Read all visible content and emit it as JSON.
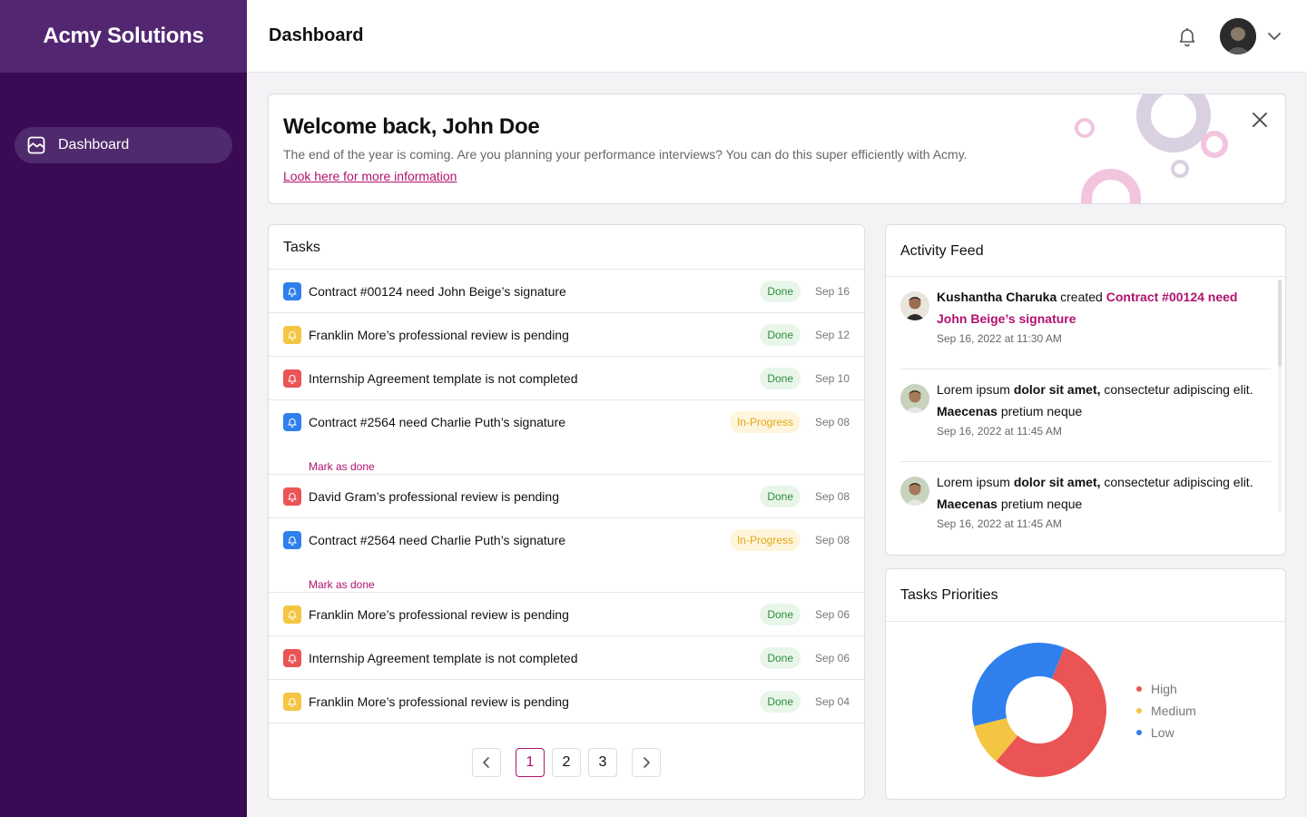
{
  "brand": {
    "name": "Acmy Solutions"
  },
  "sidebar": {
    "items": [
      {
        "label": "Dashboard",
        "icon": "image-icon"
      }
    ]
  },
  "header": {
    "title": "Dashboard",
    "bell_icon": "bell-icon",
    "menu_icon": "chevron-down-icon"
  },
  "welcome": {
    "title": "Welcome back, John Doe",
    "message": "The end of the year is coming. Are you planning your performance interviews? You can do this super efficiently with Acmy.",
    "link": "Look here for more information"
  },
  "tasks": {
    "title": "Tasks",
    "mark_done_label": "Mark as done",
    "rows": [
      {
        "text": "Contract #00124 need John Beige’s signature",
        "status": "Done",
        "date": "Sep 16",
        "priority": "low"
      },
      {
        "text": "Franklin More’s professional review is pending",
        "status": "Done",
        "date": "Sep 12",
        "priority": "medium"
      },
      {
        "text": "Internship Agreement template is not completed",
        "status": "Done",
        "date": "Sep 10",
        "priority": "high"
      },
      {
        "text": "Contract #2564 need Charlie Puth’s signature",
        "status": "In-Progress",
        "date": "Sep 08",
        "priority": "low",
        "action": "Mark as done"
      },
      {
        "text": "David Gram’s professional review is pending",
        "status": "Done",
        "date": "Sep 08",
        "priority": "high"
      },
      {
        "text": "Contract #2564 need Charlie Puth’s signature",
        "status": "In-Progress",
        "date": "Sep 08",
        "priority": "low",
        "action": "Mark as done"
      },
      {
        "text": "Franklin More’s professional review is pending",
        "status": "Done",
        "date": "Sep 06",
        "priority": "medium"
      },
      {
        "text": "Internship Agreement template is not completed",
        "status": "Done",
        "date": "Sep 06",
        "priority": "high"
      },
      {
        "text": "Franklin More’s professional review is pending",
        "status": "Done",
        "date": "Sep 04",
        "priority": "medium"
      }
    ],
    "pagination": {
      "pages": [
        "1",
        "2",
        "3"
      ],
      "current": "1"
    }
  },
  "activity": {
    "title": "Activity Feed",
    "items": [
      {
        "actor": "Kushantha Charuka",
        "verb": " created ",
        "link": "Contract #00124 need John Beige’s signature",
        "time": "Sep 16, 2022 at 11:30 AM"
      },
      {
        "t1": "Lorem ipsum ",
        "b1": "dolor sit amet,",
        "t2": " consectetur adipiscing elit. ",
        "b2": "Maecenas",
        "t3": " pretium neque",
        "time": "Sep 16, 2022 at 11:45 AM"
      },
      {
        "t1": "Lorem ipsum ",
        "b1": "dolor sit amet,",
        "t2": " consectetur adipiscing elit. ",
        "b2": "Maecenas",
        "t3": " pretium neque",
        "time": "Sep 16, 2022 at 11:45 AM"
      }
    ]
  },
  "priorities": {
    "title": "Tasks Priorities",
    "colors": {
      "high": "#ea5455",
      "medium": "#f4c542",
      "low": "#2f80ed"
    },
    "chart_data": {
      "type": "pie",
      "categories": [
        "High",
        "Medium",
        "Low"
      ],
      "values": [
        55,
        10,
        35
      ]
    }
  },
  "colors": {
    "accent": "#b0126f",
    "sidebar": "#3a0a55",
    "brand_bar": "#532672"
  }
}
